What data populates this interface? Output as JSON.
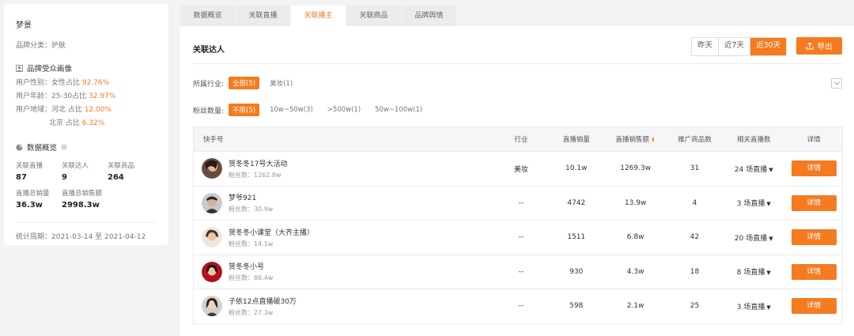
{
  "sidebar": {
    "brand_name": "梦景",
    "brand_category": "品牌分类：护肤",
    "audience_title": "品牌受众画像",
    "gender": {
      "label": "用户性别：女性占比 ",
      "value": "92.76%"
    },
    "age": {
      "label": "用户年龄：25-30占比 ",
      "value": "32.97%"
    },
    "region1": {
      "label": "用户地域：河北 占比 ",
      "value": "12.00%"
    },
    "region2": {
      "label": "北京 占比 ",
      "value": "6.32%"
    },
    "overview_title": "数据概览",
    "stats": [
      {
        "label": "关联直播",
        "value": "87"
      },
      {
        "label": "关联达人",
        "value": "9"
      },
      {
        "label": "关联商品",
        "value": "264"
      }
    ],
    "stats2": [
      {
        "label": "直播总销量",
        "value": "36.3w"
      },
      {
        "label": "直播总销售额",
        "value": "2998.3w"
      }
    ],
    "period": "统计周期：2021-03-14 至 2021-04-12"
  },
  "tabs": [
    "数据概览",
    "关联直播",
    "关联播主",
    "关联商品",
    "品牌舆情"
  ],
  "active_tab": 2,
  "main": {
    "title": "关联达人",
    "date_buttons": [
      "昨天",
      "近7天",
      "近30天"
    ],
    "active_date": 2,
    "export_label": "导出",
    "industry_label": "所属行业:",
    "industry_chips": [
      "全部(5)",
      "美妆(1)"
    ],
    "fans_label": "粉丝数量:",
    "fans_chips": [
      "不限(5)",
      "10w~50w(3)",
      ">500w(1)",
      "50w~100w(1)"
    ]
  },
  "table": {
    "headers": [
      "快手号",
      "行业",
      "直播销量",
      "直播销售额",
      "推广商品数",
      "相关直播数",
      "详情"
    ],
    "rows": [
      {
        "name": "贺冬冬17号大活动",
        "fans": "粉丝数：1262.8w",
        "industry": "美妆",
        "sales": "10.1w",
        "revenue": "1269.3w",
        "products": "31",
        "lives": "24 场直播",
        "detail": "详情"
      },
      {
        "name": "梦爷921",
        "fans": "粉丝数：30.9w",
        "industry": "--",
        "sales": "4742",
        "revenue": "13.9w",
        "products": "4",
        "lives": "3 场直播",
        "detail": "详情"
      },
      {
        "name": "贺冬冬小课堂（大齐主播）",
        "fans": "粉丝数：14.1w",
        "industry": "--",
        "sales": "1511",
        "revenue": "6.8w",
        "products": "42",
        "lives": "20 场直播",
        "detail": "详情"
      },
      {
        "name": "贺冬冬小号",
        "fans": "粉丝数：86.4w",
        "industry": "--",
        "sales": "930",
        "revenue": "4.3w",
        "products": "18",
        "lives": "8 场直播",
        "detail": "详情"
      },
      {
        "name": "子依12点直播破30万",
        "fans": "粉丝数：27.3w",
        "industry": "--",
        "sales": "598",
        "revenue": "2.1w",
        "products": "25",
        "lives": "3 场直播",
        "detail": "详情"
      }
    ]
  },
  "colors": {
    "accent": "#f47b20"
  }
}
